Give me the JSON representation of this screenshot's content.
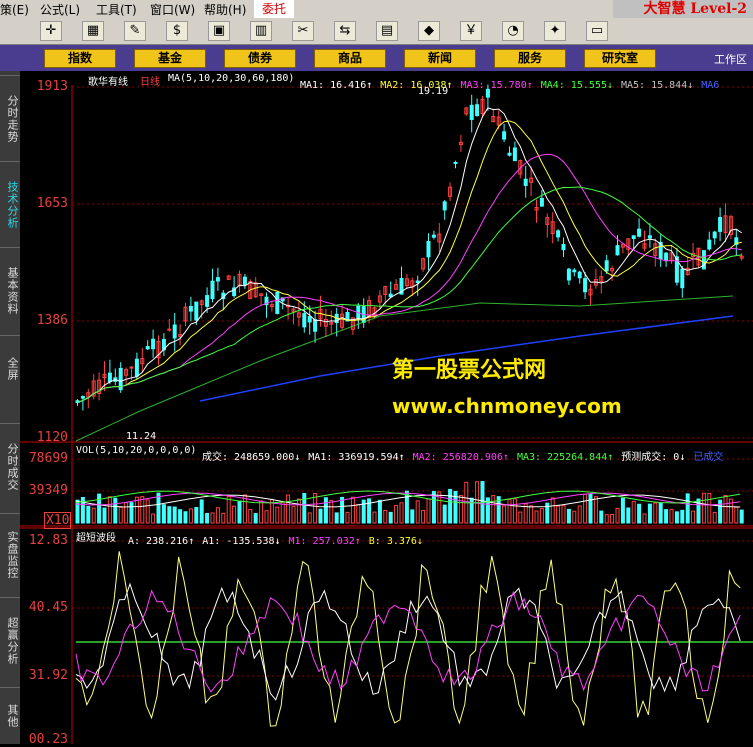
{
  "menu": {
    "items": [
      "策(E)",
      "公式(L)",
      "工具(T)",
      "窗口(W)",
      "帮助(H)"
    ],
    "trust": "委托",
    "brand": "大智慧 Level-2"
  },
  "toolbar": {
    "icons": [
      "crosshair-icon",
      "grid-icon",
      "ruler-icon",
      "dollar-icon",
      "ticker-icon",
      "chart-icon",
      "tools-icon",
      "transfer-icon",
      "table-icon",
      "diamond-icon",
      "cash-icon",
      "pie-icon",
      "star-icon",
      "layout-icon"
    ],
    "glyphs": [
      "✛",
      "▦",
      "✎",
      "$",
      "▣",
      "▥",
      "✂",
      "⇆",
      "▤",
      "◆",
      "￥",
      "◔",
      "✦",
      "▭"
    ]
  },
  "nav": {
    "buttons": [
      "指数",
      "基金",
      "债券",
      "商品",
      "新闻",
      "服务",
      "研究室"
    ],
    "workarea": "工作区"
  },
  "sidebar": {
    "tabs": [
      "分时走势",
      "技术分析",
      "基本资料",
      "全屏",
      "分时成交",
      "实盘监控",
      "超赢分析",
      "其他"
    ],
    "active_index": 1
  },
  "main_chart": {
    "stock_name": "歌华有线",
    "period": "日线",
    "ma_spec": "MA(5,10,20,30,60,180)",
    "ma_values": [
      {
        "label": "MA1: 16.416↑",
        "color": "#ffffff"
      },
      {
        "label": "MA2: 16.038↑",
        "color": "#ffff40"
      },
      {
        "label": "MA3: 15.780↑",
        "color": "#ff40ff"
      },
      {
        "label": "MA4: 15.555↓",
        "color": "#40ff40"
      },
      {
        "label": "MA5: 15.844↓",
        "color": "#c0c0c0"
      },
      {
        "label": "MA6",
        "color": "#4060ff"
      }
    ],
    "y_ticks": [
      "1913",
      "1653",
      "1386",
      "1120"
    ],
    "high_marker": "19.19",
    "low_marker": "11.24"
  },
  "volume_chart": {
    "spec": "VOL(5,10,20,0,0,0,0)",
    "values": [
      {
        "label": "成交: 248659.000↓",
        "color": "#ffffff"
      },
      {
        "label": "MA1: 336919.594↑",
        "color": "#ffffff"
      },
      {
        "label": "MA2: 256820.906↑",
        "color": "#ff40ff"
      },
      {
        "label": "MA3: 225264.844↑",
        "color": "#40ff40"
      },
      {
        "label": "预测成交: 0↓",
        "color": "#ffffff"
      },
      {
        "label": "已成交",
        "color": "#4060ff"
      }
    ],
    "y_ticks": [
      "78699",
      "39349"
    ],
    "unit": "X10"
  },
  "indicator_chart": {
    "name": "超短波段",
    "values": [
      {
        "label": "A: 238.216↑",
        "color": "#ffffff"
      },
      {
        "label": "A1: -135.538↓",
        "color": "#ffffff"
      },
      {
        "label": "M1: 257.032↑",
        "color": "#ff40ff"
      },
      {
        "label": "B: 3.376↓",
        "color": "#ffff40"
      }
    ],
    "y_ticks": [
      "12.83",
      "40.45",
      "31.92",
      "00.23"
    ]
  },
  "watermark": {
    "title": "第一股票公式网",
    "url": "www.chnmoney.com"
  },
  "colors": {
    "up": "#ff4040",
    "down": "#40ffff",
    "grid": "#8b0000",
    "ma1": "#ffffff",
    "ma2": "#ffff40",
    "ma3": "#ff40ff",
    "ma4": "#40ff40",
    "ma6": "#2040ff"
  }
}
